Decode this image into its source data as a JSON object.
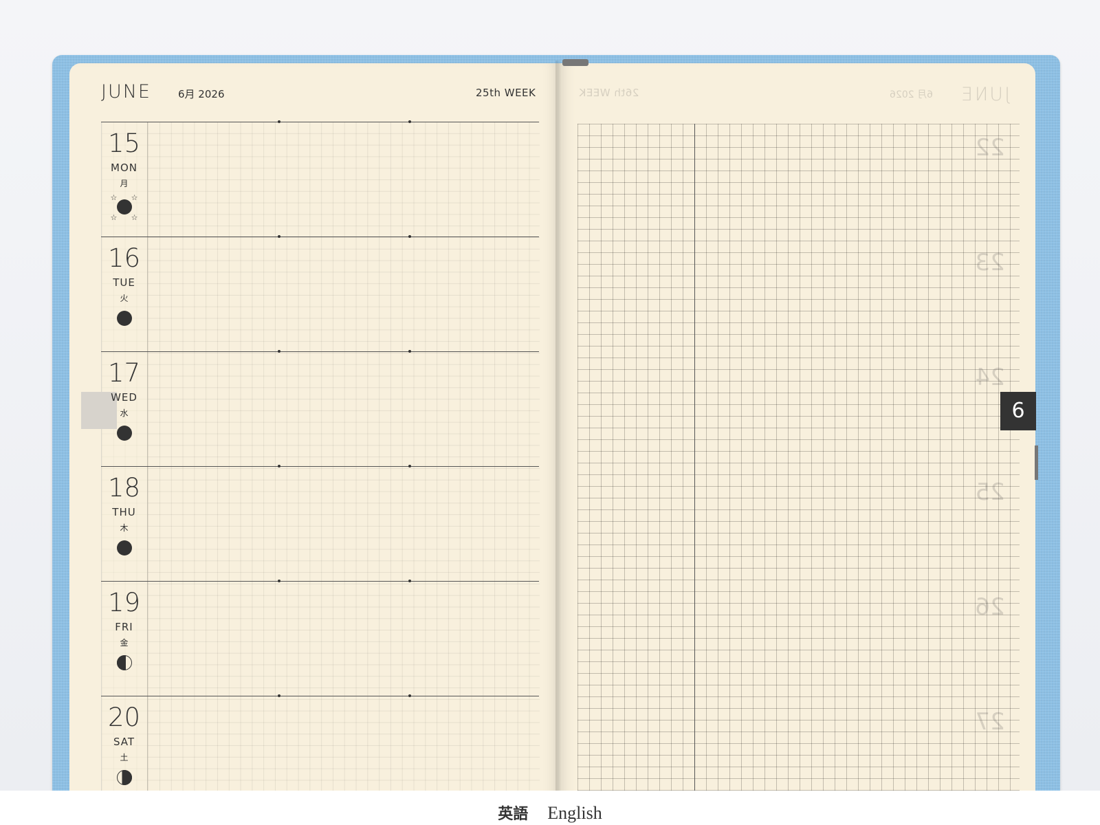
{
  "left_page": {
    "month": "JUNE",
    "month_jp": "6月 2026",
    "week": "25th WEEK",
    "days": [
      {
        "num": "15",
        "en": "MON",
        "jp": "月"
      },
      {
        "num": "16",
        "en": "TUE",
        "jp": "火"
      },
      {
        "num": "17",
        "en": "WED",
        "jp": "水"
      },
      {
        "num": "18",
        "en": "THU",
        "jp": "木"
      },
      {
        "num": "19",
        "en": "FRI",
        "jp": "金"
      },
      {
        "num": "20",
        "en": "SAT",
        "jp": "土"
      }
    ]
  },
  "right_page": {
    "month_tab": "6",
    "ghost_month": "JUNE",
    "ghost_month_jp": "6月 2026",
    "ghost_week": "26th WEEK",
    "ghost_days": [
      "22",
      "23",
      "24",
      "25",
      "26",
      "27"
    ]
  },
  "caption": {
    "jp": "英語",
    "en": "English"
  },
  "colors": {
    "cover": "#8ec1e6",
    "paper": "#f8f0dd",
    "ink": "#333333",
    "tab": "#333333"
  }
}
